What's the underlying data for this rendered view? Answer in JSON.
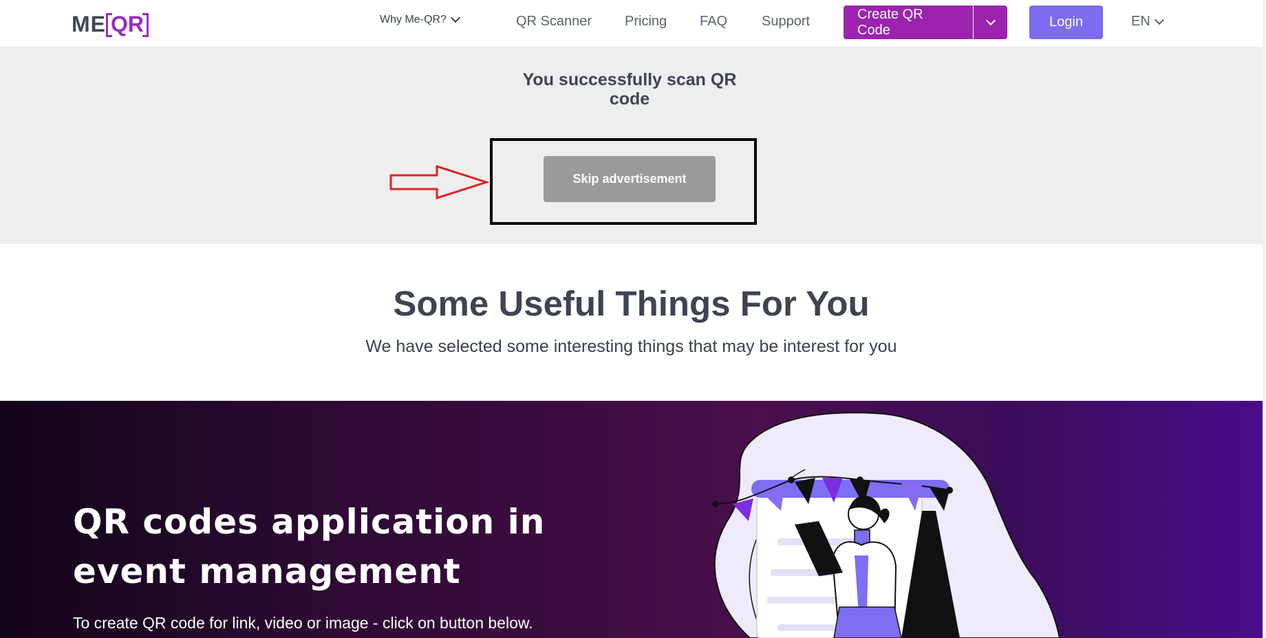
{
  "header": {
    "logo": {
      "me": "ME",
      "qr": "QR"
    },
    "nav": {
      "why": "Why Me-QR?",
      "scanner": "QR Scanner",
      "pricing": "Pricing",
      "faq": "FAQ",
      "support": "Support"
    },
    "create_button": "Create QR Code",
    "login_button": "Login",
    "language": "EN"
  },
  "scan": {
    "title": "You successfully scan QR code",
    "skip_button": "Skip advertisement"
  },
  "useful": {
    "title": "Some Useful Things For You",
    "subtitle": "We have selected some interesting things that may be interest for you"
  },
  "banner": {
    "title": "QR codes application in event management",
    "text": "To create QR code for link, video or image - click on button below."
  },
  "colors": {
    "brand_purple": "#9b23b0",
    "login_violet": "#7b6cf0",
    "skip_gray": "#9a9a9a",
    "arrow_red": "#e02020",
    "banner_dark": "#12041a"
  },
  "icons": [
    "chevron-down-icon",
    "red-arrow-icon",
    "event-illustration"
  ]
}
